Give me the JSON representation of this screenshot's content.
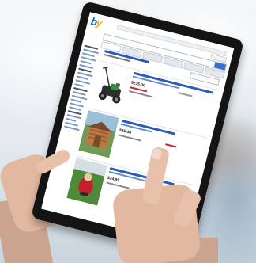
{
  "scene": {
    "description_icon": "tablet-icon"
  },
  "screen": {
    "logo_letters": [
      "b",
      "y"
    ],
    "listings": [
      {
        "price": "$235.00",
        "image": "lawn-mower"
      },
      {
        "price": "$35.00",
        "image": "garden-shed"
      },
      {
        "price": "$24.95",
        "image": "lawn-figure"
      }
    ]
  },
  "colors": {
    "link_blue": "#2a5bb8",
    "logo_blue": "#0064d2",
    "logo_yellow": "#f5af02",
    "bezel": "#141414"
  }
}
